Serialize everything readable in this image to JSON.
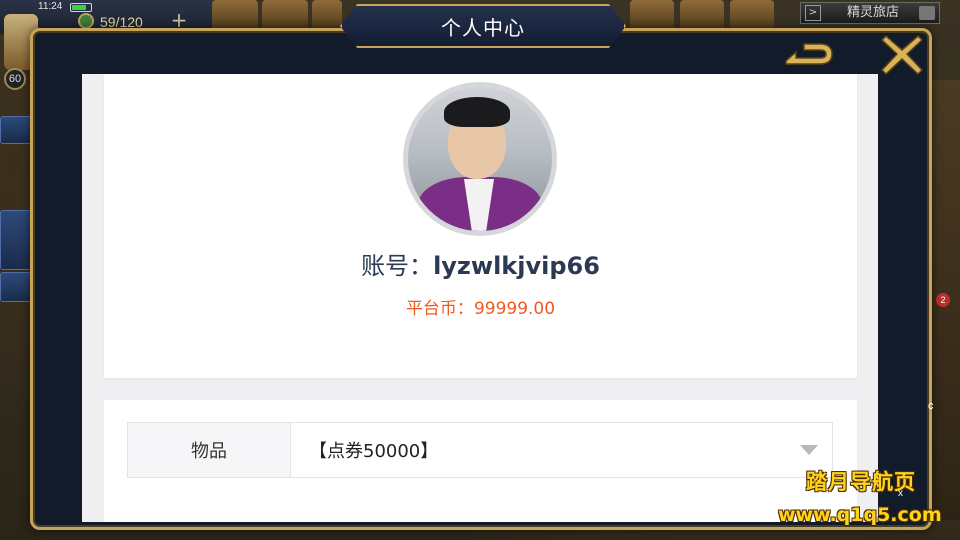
{
  "status_bar": {
    "time": "11:24",
    "energy": "59/120",
    "plus": "+",
    "level": "60"
  },
  "top_right": {
    "shop_label": "精灵旅店",
    "arrow": ">"
  },
  "notifications": {
    "badge_count": "2"
  },
  "modal": {
    "title": "个人中心"
  },
  "profile": {
    "account_label": "账号：",
    "account_value": "lyzwlkjvip66",
    "coins_label": "平台币：",
    "coins_value": "99999.00"
  },
  "items": {
    "label": "物品",
    "selected": "【点券50000】"
  },
  "watermark": {
    "title": "踏月导航页",
    "url": "www.q1q5.com",
    "close": "x"
  },
  "edge_text": "c",
  "colors": {
    "frame_gold": "#c7a45c",
    "frame_dark": "#111b2a",
    "accent_orange": "#f05a22",
    "account_text": "#2b3a52",
    "watermark_yellow": "#ffd21c"
  }
}
